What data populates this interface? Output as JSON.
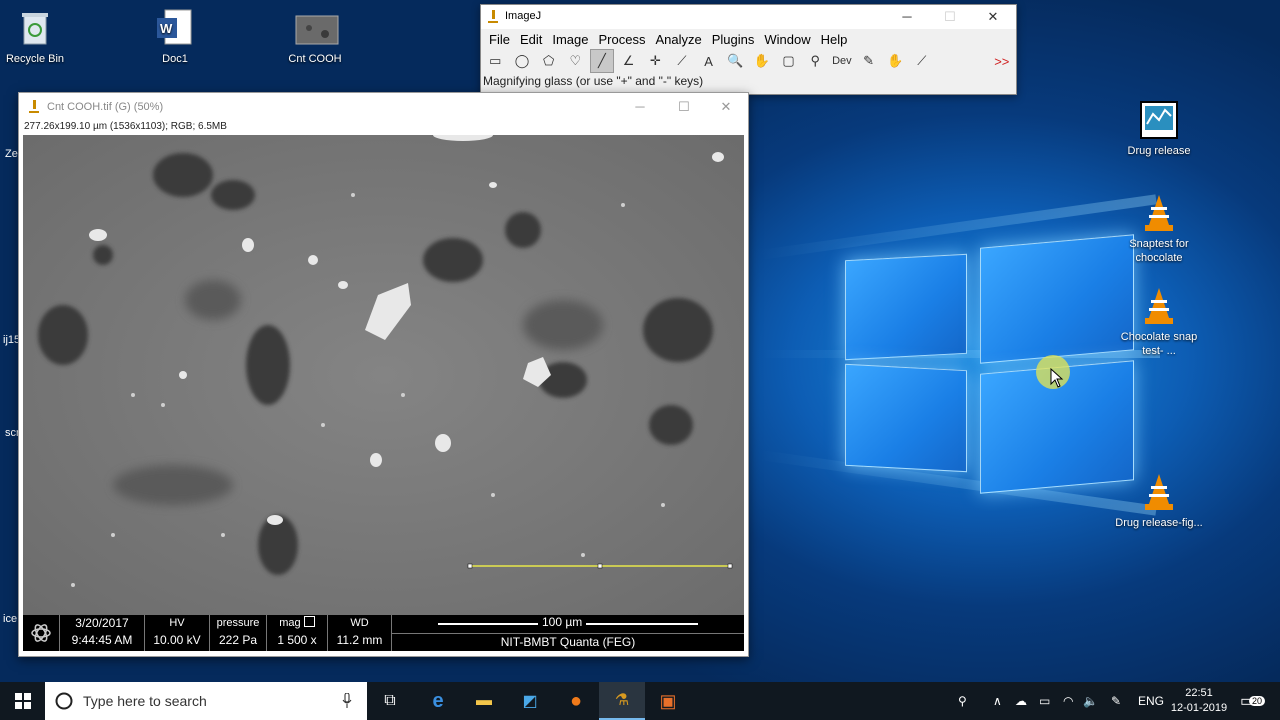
{
  "desktop": {
    "icons": [
      {
        "label": "Recycle Bin"
      },
      {
        "label": "Doc1"
      },
      {
        "label": "Cnt COOH"
      },
      {
        "label": "Drug release"
      },
      {
        "label": "Snaptest for chocolate"
      },
      {
        "label": "Chocolate snap test- ..."
      },
      {
        "label": "Drug release-fig..."
      }
    ],
    "partial_labels": [
      "Ze",
      "ij15",
      "scr",
      "ice"
    ]
  },
  "imagej": {
    "title": "ImageJ",
    "menu": [
      "File",
      "Edit",
      "Image",
      "Process",
      "Analyze",
      "Plugins",
      "Window",
      "Help"
    ],
    "tools": [
      {
        "name": "rectangle-tool-icon",
        "glyph": "▭"
      },
      {
        "name": "oval-tool-icon",
        "glyph": "◯"
      },
      {
        "name": "polygon-tool-icon",
        "glyph": "⬠"
      },
      {
        "name": "freehand-tool-icon",
        "glyph": "♡"
      },
      {
        "name": "line-tool-icon",
        "glyph": "╱"
      },
      {
        "name": "angle-tool-icon",
        "glyph": "∠"
      },
      {
        "name": "point-tool-icon",
        "glyph": "✛"
      },
      {
        "name": "wand-tool-icon",
        "glyph": "⟋"
      },
      {
        "name": "text-tool-icon",
        "glyph": "A"
      },
      {
        "name": "zoom-tool-icon",
        "glyph": "🔍"
      },
      {
        "name": "hand-tool-icon",
        "glyph": "✋"
      },
      {
        "name": "color-picker-icon",
        "glyph": "▢"
      },
      {
        "name": "magnifier-icon",
        "glyph": "⚲"
      },
      {
        "name": "dev-menu-icon",
        "glyph": "Dev"
      },
      {
        "name": "pencil-icon",
        "glyph": "✎"
      },
      {
        "name": "brush-icon",
        "glyph": "✋"
      },
      {
        "name": "dropper-icon",
        "glyph": "⟋"
      },
      {
        "name": "empty-slot-1",
        "glyph": ""
      },
      {
        "name": "empty-slot-2",
        "glyph": ""
      },
      {
        "name": "more-tools-icon",
        "glyph": ">>"
      }
    ],
    "status": "Magnifying glass (or use \"+\" and \"-\" keys)"
  },
  "image_window": {
    "title": "Cnt COOH.tif (G) (50%)",
    "info": "277.26x199.10 µm (1536x1103); RGB; 6.5MB",
    "databar": {
      "date": "3/20/2017",
      "time": "9:44:45 AM",
      "hv_label": "HV",
      "hv_value": "10.00 kV",
      "pressure_label": "pressure",
      "pressure_value": "222 Pa",
      "mag_label": "mag",
      "mag_value": "1 500 x",
      "wd_label": "WD",
      "wd_value": "11.2 mm",
      "scale_label": "100 µm",
      "instrument": "NIT-BMBT Quanta (FEG)"
    }
  },
  "taskbar": {
    "search_placeholder": "Type here to search",
    "language": "ENG",
    "time": "22:51",
    "date": "12-01-2019",
    "notifications": "20"
  },
  "colors": {
    "accent": "#76b9ed",
    "selection_line": "#e8e84a"
  }
}
